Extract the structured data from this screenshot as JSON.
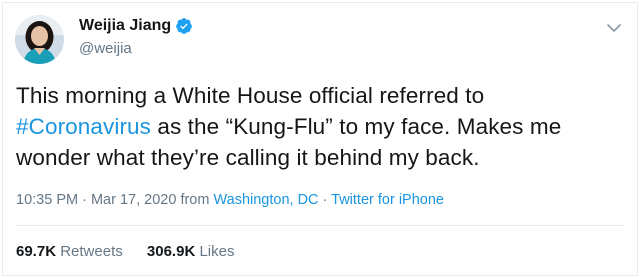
{
  "tweet": {
    "author": {
      "name": "Weijia Jiang",
      "handle": "@weijia",
      "verified": true
    },
    "text": {
      "line1": "This morning a White House official referred to",
      "hashtag": "#Coronavirus",
      "line2_rest": " as the “Kung-Flu” to my face. Makes me",
      "line3": "wonder what they’re calling it behind my back."
    },
    "meta": {
      "time": "10:35 PM",
      "sep1": " · ",
      "date": "Mar 17, 2020",
      "from_label": " from ",
      "location": "Washington, DC",
      "sep2": " · ",
      "source": "Twitter for iPhone"
    },
    "stats": {
      "retweets_count": "69.7K",
      "retweets_label": "Retweets",
      "likes_count": "306.9K",
      "likes_label": "Likes"
    }
  },
  "colors": {
    "link": "#1b95e0",
    "text": "#14171a",
    "muted": "#657786",
    "border": "#e6ecf0",
    "verified": "#1da1f2"
  },
  "icons": [
    "avatar",
    "verified-badge-icon",
    "chevron-down-icon"
  ]
}
